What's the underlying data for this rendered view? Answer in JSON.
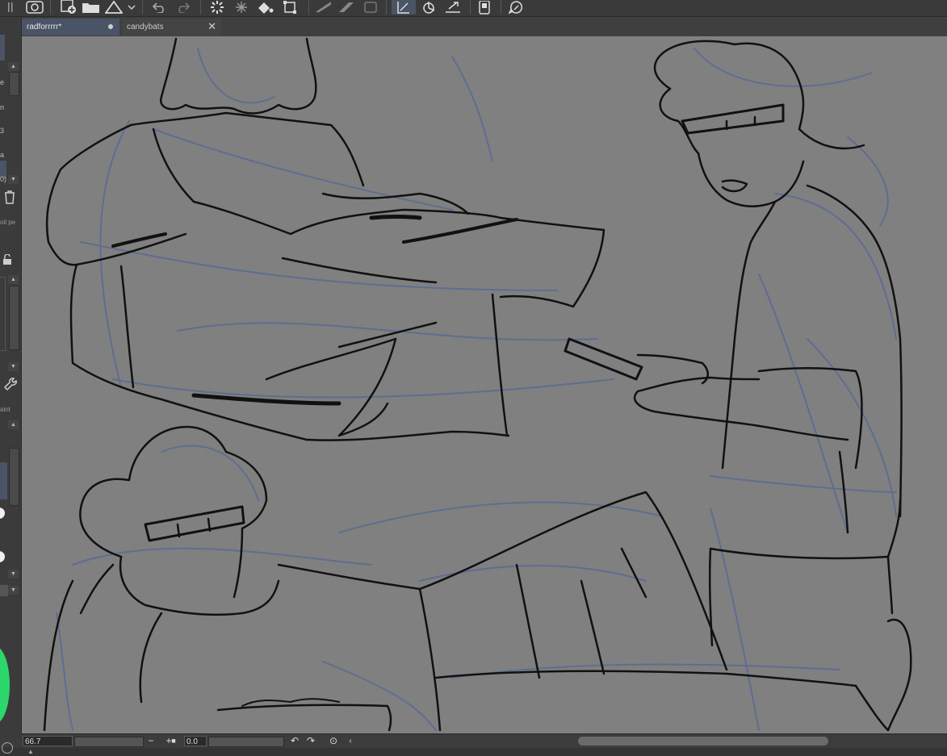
{
  "app": {
    "accent_color": "#4a5466",
    "canvas_color": "#808080",
    "sketch_line_color": "#111111",
    "sketch_blue_color": "#5b6b92",
    "color_wheel_color": "#2bd66a"
  },
  "toolbar": {
    "icons": [
      "clip-studio-icon",
      "new-canvas-icon",
      "open-folder-icon",
      "warning-icon",
      "dropdown-icon",
      "undo-icon",
      "redo-icon",
      "loading-icon",
      "transform-icon",
      "fill-icon",
      "select-icon",
      "ruler-icon",
      "pattern-icon",
      "frame-icon",
      "snap-icon",
      "pie-icon",
      "lasso-icon",
      "tablet-icon",
      "settings-icon"
    ]
  },
  "tabs": [
    {
      "label": "radforrrrr*",
      "active": true
    },
    {
      "label": "candybats",
      "active": false
    }
  ],
  "left_panel": {
    "fragments": [
      "e",
      "n",
      "3",
      "a",
      "0)",
      "oil pe",
      "aint"
    ]
  },
  "status": {
    "zoom": "66.7",
    "minus": "−",
    "plus": "+",
    "rotation": "0.0"
  }
}
